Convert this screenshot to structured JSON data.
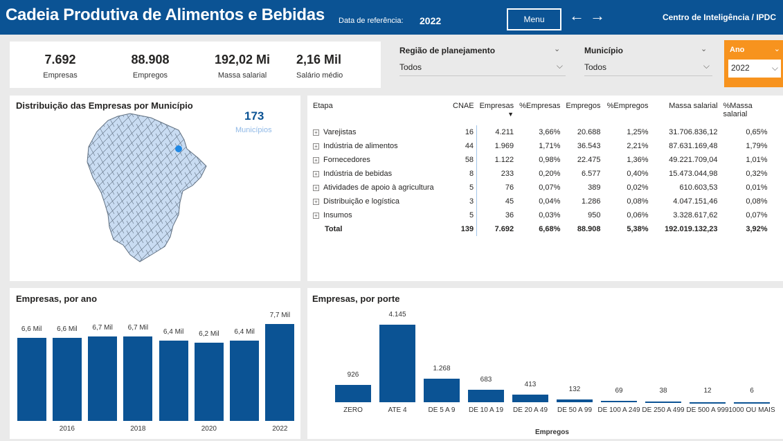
{
  "header": {
    "title": "Cadeia Produtiva de Alimentos e Bebidas",
    "ref_label": "Data de referência:",
    "ref_value": "2022",
    "menu_label": "Menu",
    "back_arrow": "←",
    "forward_arrow": "→",
    "brand": "Centro de Inteligência / IPDC"
  },
  "kpis": [
    {
      "value": "7.692",
      "label": "Empresas"
    },
    {
      "value": "88.908",
      "label": "Empregos"
    },
    {
      "value": "192,02 Mi",
      "label": "Massa salarial"
    },
    {
      "value": "2,16 Mil",
      "label": "Salário médio"
    }
  ],
  "slicers": {
    "regiao": {
      "label": "Região de planejamento",
      "value": "Todos"
    },
    "municipio": {
      "label": "Município",
      "value": "Todos"
    },
    "ano": {
      "label": "Ano",
      "value": "2022"
    }
  },
  "map": {
    "title": "Distribuição das Empresas por Município",
    "count": "173",
    "count_label": "Municípios"
  },
  "table": {
    "headers": [
      "Etapa",
      "CNAE",
      "Empresas",
      "%Empresas",
      "Empregos",
      "%Empregos",
      "Massa salarial",
      "%Massa salarial"
    ],
    "rows": [
      [
        "Varejistas",
        "16",
        "4.211",
        "3,66%",
        "20.688",
        "1,25%",
        "31.706.836,12",
        "0,65%"
      ],
      [
        "Indústria de alimentos",
        "44",
        "1.969",
        "1,71%",
        "36.543",
        "2,21%",
        "87.631.169,48",
        "1,79%"
      ],
      [
        "Fornecedores",
        "58",
        "1.122",
        "0,98%",
        "22.475",
        "1,36%",
        "49.221.709,04",
        "1,01%"
      ],
      [
        "Indústria de bebidas",
        "8",
        "233",
        "0,20%",
        "6.577",
        "0,40%",
        "15.473.044,98",
        "0,32%"
      ],
      [
        "Atividades de apoio à agricultura",
        "5",
        "76",
        "0,07%",
        "389",
        "0,02%",
        "610.603,53",
        "0,01%"
      ],
      [
        "Distribuição e logística",
        "3",
        "45",
        "0,04%",
        "1.286",
        "0,08%",
        "4.047.151,46",
        "0,08%"
      ],
      [
        "Insumos",
        "5",
        "36",
        "0,03%",
        "950",
        "0,06%",
        "3.328.617,62",
        "0,07%"
      ]
    ],
    "total": [
      "Total",
      "139",
      "7.692",
      "6,68%",
      "88.908",
      "5,38%",
      "192.019.132,23",
      "3,92%"
    ]
  },
  "chart_data": [
    {
      "type": "bar",
      "title": "Empresas, por ano",
      "categories": [
        "2015",
        "2016",
        "2017",
        "2018",
        "2019",
        "2020",
        "2021",
        "2022"
      ],
      "tick_labels": [
        "",
        "2016",
        "",
        "2018",
        "",
        "2020",
        "",
        "2022"
      ],
      "values": [
        6.6,
        6.6,
        6.7,
        6.7,
        6.4,
        6.2,
        6.4,
        7.7
      ],
      "data_labels": [
        "6,6 Mil",
        "6,6 Mil",
        "6,7 Mil",
        "6,7 Mil",
        "6,4 Mil",
        "6,2 Mil",
        "6,4 Mil",
        "7,7 Mil"
      ],
      "ylim": [
        0,
        7.7
      ],
      "color": "#0b5394"
    },
    {
      "type": "bar",
      "title": "Empresas, por porte",
      "xlabel": "Empregos",
      "categories": [
        "ZERO",
        "ATE 4",
        "DE 5 A 9",
        "DE 10 A 19",
        "DE 20 A 49",
        "DE 50 A 99",
        "DE 100 A 249",
        "DE 250 A 499",
        "DE 500 A 999",
        "1000 OU MAIS"
      ],
      "values": [
        926,
        4145,
        1268,
        683,
        413,
        132,
        69,
        38,
        12,
        6
      ],
      "data_labels": [
        "926",
        "4.145",
        "1.268",
        "683",
        "413",
        "132",
        "69",
        "38",
        "12",
        "6"
      ],
      "ylim": [
        0,
        4145
      ],
      "color": "#0b5394"
    }
  ],
  "colors": {
    "header": "#0b5394",
    "ano_slicer": "#f7931e",
    "bar": "#0b5394",
    "map_fill": "#c9dcf2"
  }
}
